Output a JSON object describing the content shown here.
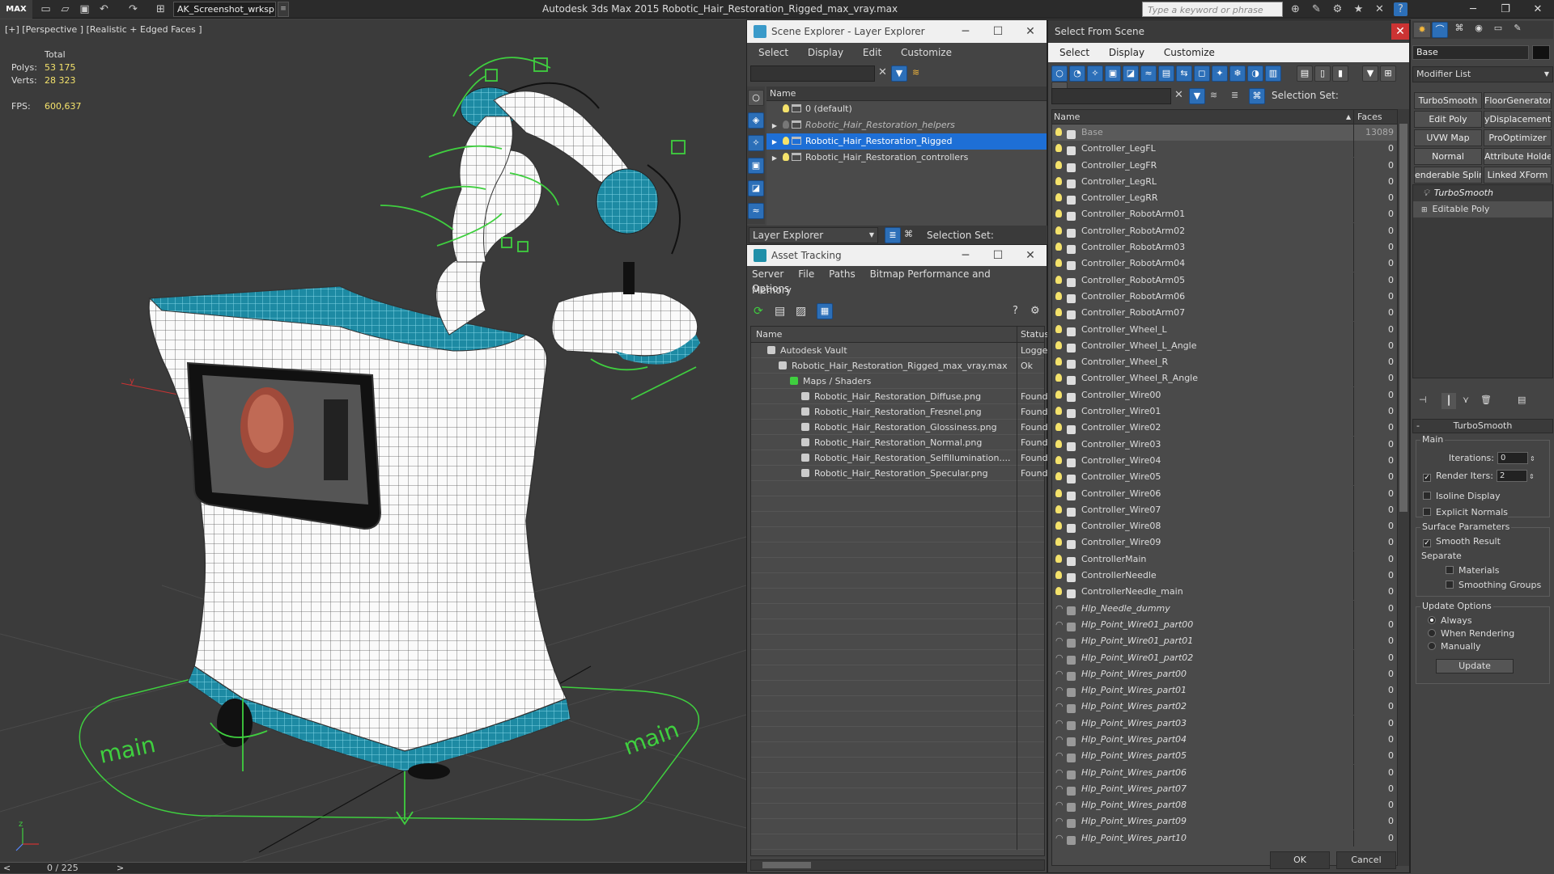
{
  "app": {
    "logo": "MAX",
    "workspace": "AK_Screenshot_wrksp",
    "title": "Autodesk 3ds Max  2015     Robotic_Hair_Restoration_Rigged_max_vray.max",
    "search_placeholder": "Type a keyword or phrase"
  },
  "viewport": {
    "label": "[+] [Perspective ] [Realistic + Edged Faces ]",
    "stats": {
      "total_label": "Total",
      "polys_label": "Polys:",
      "polys": "53 175",
      "verts_label": "Verts:",
      "verts": "28 323",
      "fps_label": "FPS:",
      "fps": "600,637"
    },
    "floor_text_left": "main",
    "floor_text_right": "main",
    "axis_x": "x",
    "axis_y": "y",
    "axis_z": "z"
  },
  "timeline": {
    "frame": "0 / 225",
    "prev": "<",
    "next": ">"
  },
  "scene_explorer": {
    "title": "Scene Explorer - Layer Explorer",
    "menu": [
      "Select",
      "Display",
      "Edit",
      "Customize"
    ],
    "column_name": "Name",
    "layers": [
      {
        "name": "0 (default)",
        "on": true,
        "italic": false,
        "selected": false,
        "expand": false
      },
      {
        "name": "Robotic_Hair_Restoration_helpers",
        "on": false,
        "italic": true,
        "selected": false,
        "expand": true
      },
      {
        "name": "Robotic_Hair_Restoration_Rigged",
        "on": true,
        "italic": false,
        "selected": true,
        "expand": true
      },
      {
        "name": "Robotic_Hair_Restoration_controllers",
        "on": true,
        "italic": false,
        "selected": false,
        "expand": true
      }
    ],
    "footer_dropdown": "Layer Explorer",
    "selection_set_label": "Selection Set:"
  },
  "asset_tracking": {
    "title": "Asset Tracking",
    "menu": [
      "Server",
      "File",
      "Paths",
      "Bitmap Performance and Memory"
    ],
    "menu2": "Options",
    "col_name": "Name",
    "col_status": "Status",
    "rows": [
      {
        "indent": 1,
        "name": "Autodesk Vault",
        "status": "Logge"
      },
      {
        "indent": 2,
        "name": "Robotic_Hair_Restoration_Rigged_max_vray.max",
        "status": "Ok"
      },
      {
        "indent": 3,
        "name": "Maps / Shaders",
        "status": ""
      },
      {
        "indent": 4,
        "name": "Robotic_Hair_Restoration_Diffuse.png",
        "status": "Found"
      },
      {
        "indent": 4,
        "name": "Robotic_Hair_Restoration_Fresnel.png",
        "status": "Found"
      },
      {
        "indent": 4,
        "name": "Robotic_Hair_Restoration_Glossiness.png",
        "status": "Found"
      },
      {
        "indent": 4,
        "name": "Robotic_Hair_Restoration_Normal.png",
        "status": "Found"
      },
      {
        "indent": 4,
        "name": "Robotic_Hair_Restoration_Selfillumination....",
        "status": "Found"
      },
      {
        "indent": 4,
        "name": "Robotic_Hair_Restoration_Specular.png",
        "status": "Found"
      }
    ]
  },
  "select_from_scene": {
    "title": "Select From Scene",
    "menu": [
      "Select",
      "Display",
      "Customize"
    ],
    "selection_set_label": "Selection Set:",
    "col_name": "Name",
    "col_faces": "Faces",
    "objects": [
      {
        "name": "Base",
        "faces": "13089",
        "type": "geo",
        "selected": true
      },
      {
        "name": "Controller_LegFL",
        "faces": "0",
        "type": "ctrl"
      },
      {
        "name": "Controller_LegFR",
        "faces": "0",
        "type": "ctrl"
      },
      {
        "name": "Controller_LegRL",
        "faces": "0",
        "type": "ctrl"
      },
      {
        "name": "Controller_LegRR",
        "faces": "0",
        "type": "ctrl"
      },
      {
        "name": "Controller_RobotArm01",
        "faces": "0",
        "type": "ctrl"
      },
      {
        "name": "Controller_RobotArm02",
        "faces": "0",
        "type": "ctrl"
      },
      {
        "name": "Controller_RobotArm03",
        "faces": "0",
        "type": "ctrl"
      },
      {
        "name": "Controller_RobotArm04",
        "faces": "0",
        "type": "ctrl"
      },
      {
        "name": "Controller_RobotArm05",
        "faces": "0",
        "type": "ctrl"
      },
      {
        "name": "Controller_RobotArm06",
        "faces": "0",
        "type": "ctrl"
      },
      {
        "name": "Controller_RobotArm07",
        "faces": "0",
        "type": "ctrl"
      },
      {
        "name": "Controller_Wheel_L",
        "faces": "0",
        "type": "ctrl"
      },
      {
        "name": "Controller_Wheel_L_Angle",
        "faces": "0",
        "type": "ctrl"
      },
      {
        "name": "Controller_Wheel_R",
        "faces": "0",
        "type": "ctrl"
      },
      {
        "name": "Controller_Wheel_R_Angle",
        "faces": "0",
        "type": "ctrl"
      },
      {
        "name": "Controller_Wire00",
        "faces": "0",
        "type": "ctrl"
      },
      {
        "name": "Controller_Wire01",
        "faces": "0",
        "type": "ctrl"
      },
      {
        "name": "Controller_Wire02",
        "faces": "0",
        "type": "ctrl"
      },
      {
        "name": "Controller_Wire03",
        "faces": "0",
        "type": "ctrl"
      },
      {
        "name": "Controller_Wire04",
        "faces": "0",
        "type": "ctrl"
      },
      {
        "name": "Controller_Wire05",
        "faces": "0",
        "type": "ctrl"
      },
      {
        "name": "Controller_Wire06",
        "faces": "0",
        "type": "ctrl"
      },
      {
        "name": "Controller_Wire07",
        "faces": "0",
        "type": "ctrl"
      },
      {
        "name": "Controller_Wire08",
        "faces": "0",
        "type": "ctrl"
      },
      {
        "name": "Controller_Wire09",
        "faces": "0",
        "type": "ctrl"
      },
      {
        "name": "ControllerMain",
        "faces": "0",
        "type": "ctrl"
      },
      {
        "name": "ControllerNeedle",
        "faces": "0",
        "type": "ctrl"
      },
      {
        "name": "ControllerNeedle_main",
        "faces": "0",
        "type": "ctrl"
      },
      {
        "name": "Hlp_Needle_dummy",
        "faces": "0",
        "type": "helper"
      },
      {
        "name": "Hlp_Point_Wire01_part00",
        "faces": "0",
        "type": "helper"
      },
      {
        "name": "Hlp_Point_Wire01_part01",
        "faces": "0",
        "type": "helper"
      },
      {
        "name": "Hlp_Point_Wire01_part02",
        "faces": "0",
        "type": "helper"
      },
      {
        "name": "Hlp_Point_Wires_part00",
        "faces": "0",
        "type": "helper"
      },
      {
        "name": "Hlp_Point_Wires_part01",
        "faces": "0",
        "type": "helper"
      },
      {
        "name": "Hlp_Point_Wires_part02",
        "faces": "0",
        "type": "helper"
      },
      {
        "name": "Hlp_Point_Wires_part03",
        "faces": "0",
        "type": "helper"
      },
      {
        "name": "Hlp_Point_Wires_part04",
        "faces": "0",
        "type": "helper"
      },
      {
        "name": "Hlp_Point_Wires_part05",
        "faces": "0",
        "type": "helper"
      },
      {
        "name": "Hlp_Point_Wires_part06",
        "faces": "0",
        "type": "helper"
      },
      {
        "name": "Hlp_Point_Wires_part07",
        "faces": "0",
        "type": "helper"
      },
      {
        "name": "Hlp_Point_Wires_part08",
        "faces": "0",
        "type": "helper"
      },
      {
        "name": "Hlp_Point_Wires_part09",
        "faces": "0",
        "type": "helper"
      },
      {
        "name": "Hlp_Point_Wires_part10",
        "faces": "0",
        "type": "helper"
      }
    ],
    "ok": "OK",
    "cancel": "Cancel"
  },
  "command_panel": {
    "object_name": "Base",
    "modifier_list": "Modifier List",
    "buttons": [
      "TurboSmooth",
      "FloorGenerator",
      "Edit Poly",
      "yDisplacement",
      "UVW Map",
      "ProOptimizer",
      "Normal",
      "Attribute Holde",
      "enderable Splin",
      "Linked XForm"
    ],
    "stack": [
      "TurboSmooth",
      "Editable Poly"
    ],
    "rollout_title": "TurboSmooth",
    "main_label": "Main",
    "iterations_label": "Iterations:",
    "iterations": "0",
    "render_iters_label": "Render Iters:",
    "render_iters": "2",
    "isoline": "Isoline Display",
    "explicit": "Explicit Normals",
    "surface_label": "Surface Parameters",
    "smooth_result": "Smooth Result",
    "separate_label": "Separate",
    "materials": "Materials",
    "smoothing_groups": "Smoothing Groups",
    "update_options_label": "Update Options",
    "always": "Always",
    "when_rendering": "When Rendering",
    "manually": "Manually",
    "update": "Update"
  },
  "colors": {
    "selection": "#1e6fd6",
    "teal": "#1f8fa8",
    "controller_green": "#3fcf3f",
    "bulb": "#f4e26b"
  }
}
